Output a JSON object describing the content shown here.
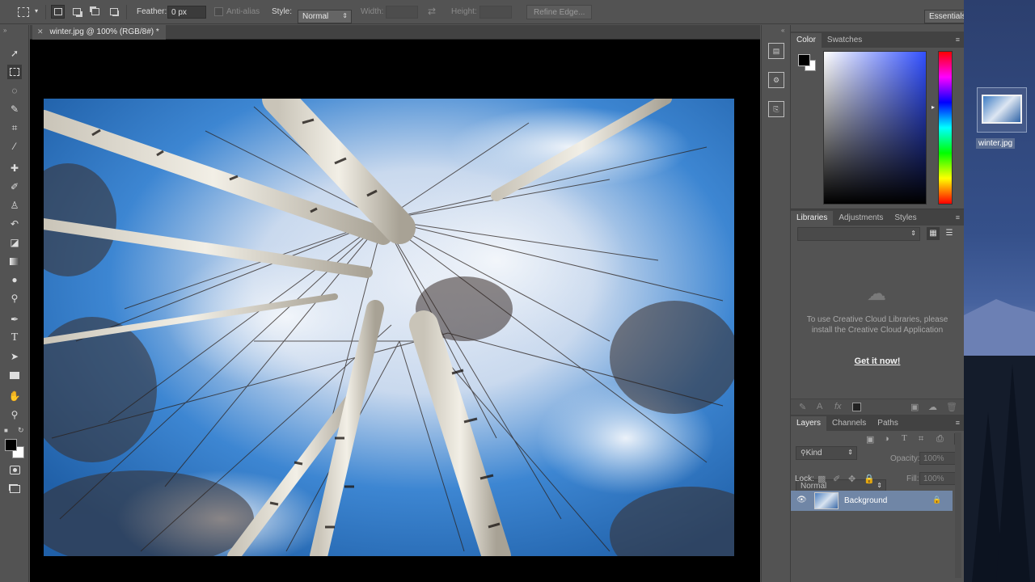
{
  "options_bar": {
    "feather_label": "Feather:",
    "feather_value": "0 px",
    "anti_alias_label": "Anti-alias",
    "style_label": "Style:",
    "style_value": "Normal",
    "width_label": "Width:",
    "height_label": "Height:",
    "refine_edge_label": "Refine Edge...",
    "workspace_value": "Essentials"
  },
  "document": {
    "tab_title": "winter.jpg @ 100% (RGB/8#) *"
  },
  "panels": {
    "color": {
      "tabs": [
        "Color",
        "Swatches"
      ],
      "foreground": "#000000",
      "background": "#ffffff",
      "hue": "#3250ff"
    },
    "libraries": {
      "tabs": [
        "Libraries",
        "Adjustments",
        "Styles"
      ],
      "message": "To use Creative Cloud Libraries, please install the Creative Cloud Application",
      "link": "Get it now!"
    },
    "layers": {
      "tabs": [
        "Layers",
        "Channels",
        "Paths"
      ],
      "filter_kind": "Kind",
      "blend_mode": "Normal",
      "opacity_label": "Opacity:",
      "opacity_value": "100%",
      "lock_label": "Lock:",
      "fill_label": "Fill:",
      "fill_value": "100%",
      "items": [
        {
          "name": "Background",
          "locked": true,
          "visible": true
        }
      ]
    }
  },
  "desktop": {
    "file_label": "winter.jpg"
  },
  "colors": {
    "chrome": "#535353",
    "panel_dark": "#424242",
    "selected_layer": "#7086a6"
  }
}
